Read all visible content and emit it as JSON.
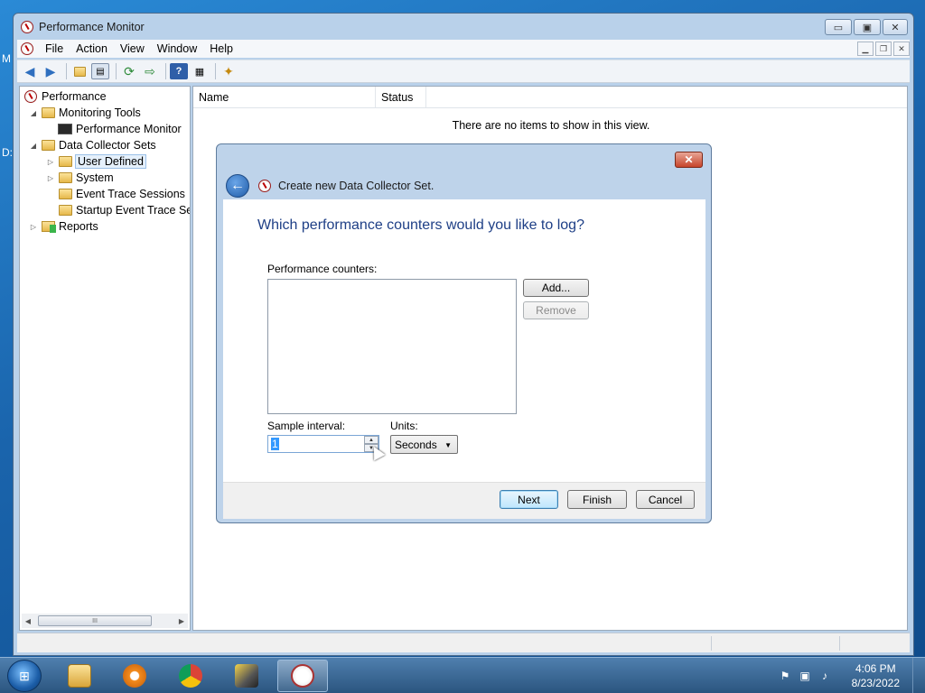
{
  "desktop": {
    "frag1": "M",
    "frag2": "D:"
  },
  "window": {
    "title": "Performance Monitor",
    "minimize": "▭",
    "maximize": "▣",
    "close": "✕"
  },
  "menu": {
    "items": [
      "File",
      "Action",
      "View",
      "Window",
      "Help"
    ]
  },
  "tree": {
    "root": "Performance",
    "monitoring_tools": "Monitoring Tools",
    "performance_monitor": "Performance Monitor",
    "data_collector_sets": "Data Collector Sets",
    "user_defined": "User Defined",
    "system": "System",
    "event_trace_sessions": "Event Trace Sessions",
    "startup_event_trace": "Startup Event Trace Ses",
    "reports": "Reports",
    "scroll_grip": "III"
  },
  "list": {
    "col_name": "Name",
    "col_status": "Status",
    "empty_message": "There are no items to show in this view."
  },
  "dialog": {
    "close": "✕",
    "title": "Create new Data Collector Set.",
    "heading": "Which performance counters would you like to log?",
    "counters_label": "Performance counters:",
    "add_button": "Add...",
    "remove_button": "Remove",
    "sample_interval_label": "Sample interval:",
    "sample_interval_value": "1",
    "units_label": "Units:",
    "units_value": "Seconds",
    "next_button": "Next",
    "finish_button": "Finish",
    "cancel_button": "Cancel"
  },
  "taskbar": {
    "apps": [
      "windows-explorer",
      "media-player",
      "chrome",
      "network-tool",
      "performance-monitor"
    ],
    "time": "4:06 PM",
    "date": "8/23/2022"
  },
  "colors": {
    "dialog_heading": "#1e3f86",
    "selection": "#3399ff",
    "taskbar": "#2b557f"
  }
}
